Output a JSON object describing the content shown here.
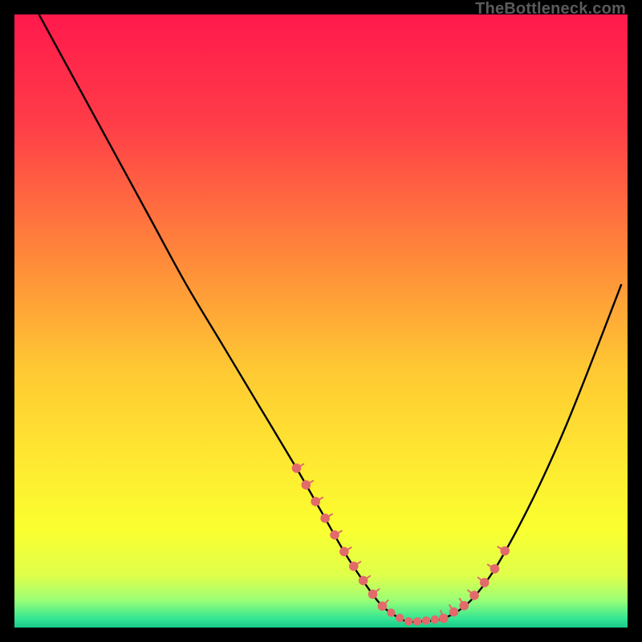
{
  "watermark": "TheBottleneck.com",
  "chart_data": {
    "type": "line",
    "title": "",
    "xlabel": "",
    "ylabel": "",
    "xlim": [
      0,
      100
    ],
    "ylim": [
      0,
      100
    ],
    "grid": false,
    "legend": false,
    "series": [
      {
        "name": "bottleneck-curve",
        "x": [
          4,
          10,
          16,
          22,
          28,
          34,
          40,
          46,
          50,
          54,
          58,
          60,
          62,
          64,
          66,
          70,
          74,
          78,
          82,
          86,
          90,
          94,
          99
        ],
        "values": [
          100,
          89,
          78,
          67,
          56,
          46,
          36,
          26,
          19,
          12,
          6,
          3.5,
          2,
          1,
          1,
          1.5,
          4,
          9,
          16,
          24,
          33,
          43,
          56
        ]
      }
    ],
    "highlight_ranges": [
      {
        "series": "bottleneck-curve",
        "x_from": 46,
        "x_to": 60,
        "note": "left-dots"
      },
      {
        "series": "bottleneck-curve",
        "x_from": 60,
        "x_to": 70,
        "note": "valley-dots"
      },
      {
        "series": "bottleneck-curve",
        "x_from": 70,
        "x_to": 80,
        "note": "right-dots"
      }
    ],
    "gradient_stops": [
      {
        "t": 0.0,
        "color": "#ff194c"
      },
      {
        "t": 0.18,
        "color": "#ff3d48"
      },
      {
        "t": 0.4,
        "color": "#ff8a3a"
      },
      {
        "t": 0.58,
        "color": "#ffc933"
      },
      {
        "t": 0.72,
        "color": "#ffe731"
      },
      {
        "t": 0.84,
        "color": "#faff30"
      },
      {
        "t": 0.915,
        "color": "#dfff4a"
      },
      {
        "t": 0.955,
        "color": "#9cff75"
      },
      {
        "t": 0.985,
        "color": "#35e693"
      },
      {
        "t": 1.0,
        "color": "#17c98a"
      }
    ],
    "dot_color": "#e26a6a"
  }
}
